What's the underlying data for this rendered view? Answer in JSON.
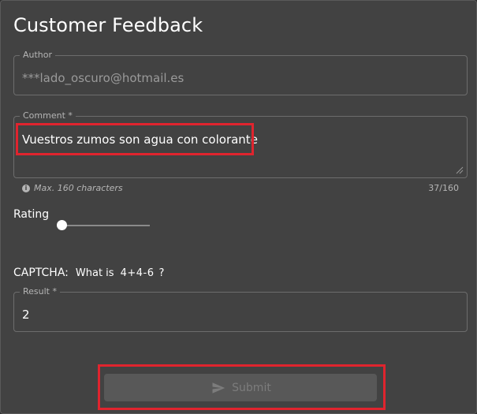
{
  "page": {
    "title": "Customer Feedback"
  },
  "author": {
    "label": "Author",
    "value": "***lado_oscuro@hotmail.es"
  },
  "comment": {
    "label": "Comment *",
    "value": "Vuestros zumos son agua con colorante",
    "hint": "Max. 160 characters",
    "counter": "37/160",
    "hint_icon": "info-icon"
  },
  "rating": {
    "label": "Rating",
    "value_fraction": 0.0
  },
  "captcha": {
    "label": "CAPTCHA:",
    "question": "What is",
    "expression": "4+4-6",
    "question_mark": "?"
  },
  "result": {
    "label": "Result *",
    "value": "2"
  },
  "submit": {
    "label": "Submit",
    "icon": "send-icon",
    "disabled": true
  },
  "colors": {
    "background": "#424242",
    "highlight": "#e0242e",
    "disabled_button": "#585858"
  }
}
